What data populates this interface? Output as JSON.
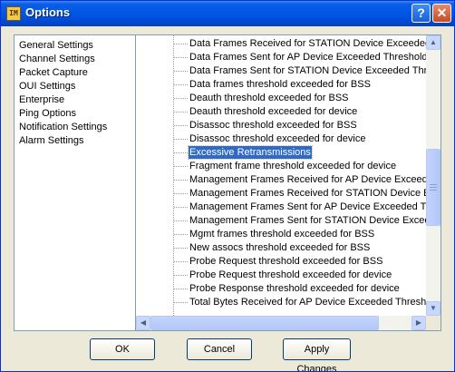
{
  "window": {
    "title": "Options",
    "icon_name": "app-icon",
    "icon_text": "IM",
    "help_label": "?",
    "close_label": "✕"
  },
  "left_list": {
    "items": [
      "General Settings",
      "Channel Settings",
      "Packet Capture",
      "OUI Settings",
      "Enterprise",
      "Ping Options",
      "Notification Settings",
      "Alarm Settings"
    ]
  },
  "alarm_list": {
    "items": [
      "Data Frames Received for STATION Device  Exceeded T",
      "Data Frames Sent for AP Device  Exceeded Thresholds",
      "Data Frames Sent for STATION Device  Exceeded Thresh",
      "Data frames threshold exceeded for BSS",
      "Deauth threshold exceeded for BSS",
      "Deauth threshold exceeded for device",
      "Disassoc threshold exceeded for BSS",
      "Disassoc threshold exceeded for device",
      "Excessive Retransmissions",
      "Fragment frame threshold exceeded for device",
      "Management Frames Received for AP Device  Exceeded",
      "Management Frames Received for STATION Device  Exc",
      "Management Frames Sent for AP Device  Exceeded Thres",
      "Management Frames Sent for STATION Device  Exceede",
      "Mgmt frames threshold exceeded for BSS",
      "New assocs threshold exceeded for BSS",
      "Probe Request threshold exceeded for BSS",
      "Probe Request threshold exceeded for device",
      "Probe Response threshold exceeded for device",
      "Total Bytes Received for AP Device  Exceeded Threshold"
    ],
    "selected": "Excessive Retransmissions"
  },
  "scrollbars": {
    "up_arrow": "▲",
    "down_arrow": "▼",
    "left_arrow": "◀",
    "right_arrow": "▶"
  },
  "buttons": {
    "ok": "OK",
    "cancel": "Cancel",
    "apply": "Apply Changes"
  },
  "colors": {
    "title_bar": "#0055e5",
    "selection": "#316ac5",
    "dialog_bg": "#ece9d8"
  }
}
